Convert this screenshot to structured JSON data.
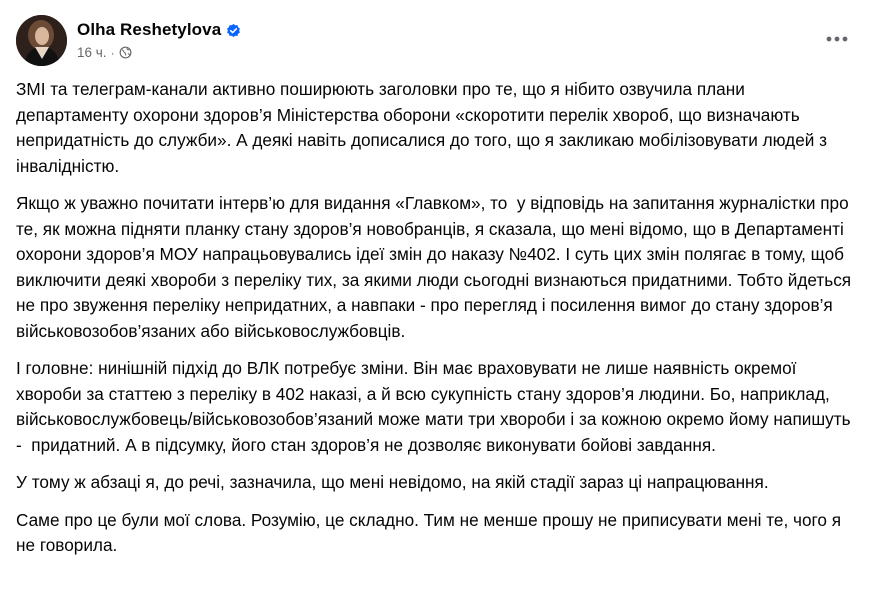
{
  "post": {
    "author": "Olha Reshetylova",
    "time": "16 ч.",
    "separator": "·",
    "verified_badge": "verified-icon",
    "audience_icon": "globe-icon",
    "more_icon": "more-horizontal-icon",
    "paragraphs": [
      "ЗМІ та телеграм-канали активно поширюють заголовки про те, що я нібито озвучила плани департаменту охорони здоров’я Міністерства оборони «скоротити перелік хвороб, що визначають непридатність до служби». А деякі навіть дописалися до того, що я закликаю мобілізовувати людей з інвалідністю.",
      "Якщо ж уважно почитати інтерв’ю для видання «Главком», то  у відповідь на запитання журналістки про те, як можна підняти планку стану здоров’я новобранців, я сказала, що мені відомо, що в Департаменті охорони здоров’я МОУ напрацьовувались ідеї змін до наказу №402. І суть цих змін полягає в тому, щоб виключити деякі хвороби з переліку тих, за якими люди сьогодні визнаються придатними. Тобто йдеться не про звуження переліку непридатних, а навпаки - про перегляд і посилення вимог до стану здоров’я військовозобов’язаних або військовослужбовців.",
      "І головне: нинішній підхід до ВЛК потребує зміни. Він має враховувати не лише наявність окремої хвороби за статтею з переліку в 402 наказі, а й всю сукупність стану здоров’я людини. Бо, наприклад, військовослужбовець/військовозобов’язаний може мати три хвороби і за кожною окремо йому напишуть -  придатний. А в підсумку, його стан здоров’я не дозволяє виконувати бойові завдання.",
      "У тому ж абзаці я, до речі, зазначила, що мені невідомо, на якій стадії зараз ці напрацювання.",
      "Саме про це були мої слова. Розумію, це складно. Тим не менше прошу не приписувати мені те, чого я не говорила."
    ]
  },
  "colors": {
    "text": "#050505",
    "secondary_text": "#65676b",
    "verified_blue": "#0866ff",
    "background": "#ffffff"
  }
}
